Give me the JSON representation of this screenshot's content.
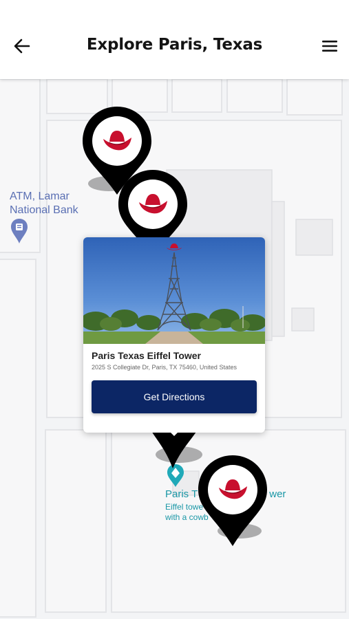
{
  "header": {
    "title": "Explore Paris, Texas",
    "back_icon": "arrow-left-icon",
    "menu_icon": "hamburger-menu-icon"
  },
  "map": {
    "pois": [
      {
        "name": "ATM, Lamar",
        "name_line2": "National Bank",
        "icon": "atm-pin-icon",
        "color": "#5a6fb3"
      },
      {
        "name": "Paris Texas Eiffel Tower",
        "visible_start": "Paris T",
        "visible_end": "wer",
        "desc_line1": "Eiffel towe",
        "desc_line2": "with a cowb",
        "icon": "landmark-pin-icon",
        "color": "#1a97a6"
      }
    ],
    "marker_icon": "cowboy-hat-icon",
    "marker_hat_color": "#c8102e"
  },
  "card": {
    "name": "Paris Texas Eiffel Tower",
    "address": "2025 S Collegiate Dr, Paris, TX 75460, United States",
    "button_label": "Get Directions",
    "button_color": "#0c2665"
  }
}
